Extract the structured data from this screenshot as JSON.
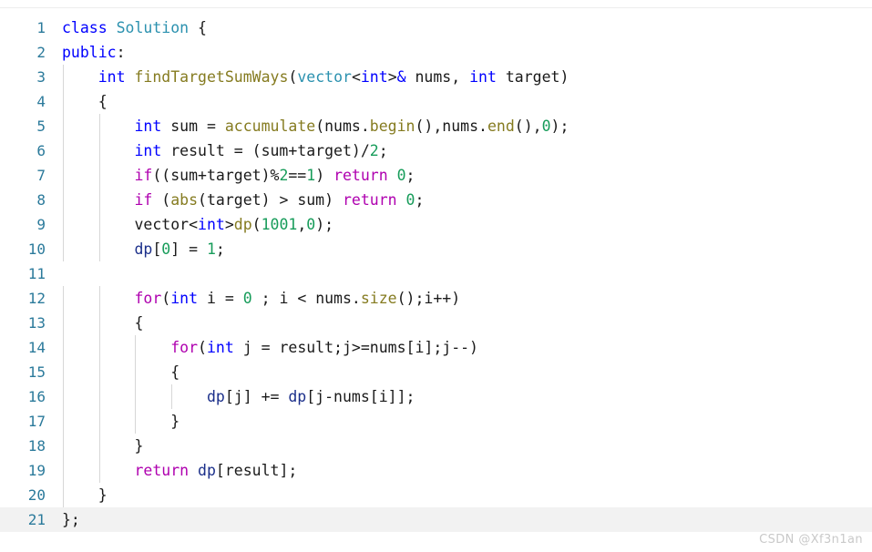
{
  "editor": {
    "language": "cpp",
    "total_lines": 21,
    "current_line": 21,
    "gutter_color": "#2b7a9b",
    "background": "#ffffff",
    "current_line_background": "#f2f2f2"
  },
  "palette": {
    "keyword": "#0000ff",
    "control": "#af00af",
    "type": "#2b91af",
    "function": "#857b20",
    "number": "#179c5a",
    "variable": "#1b2f8a",
    "plain": "#1a1a1a",
    "indent_guide": "#d7d7d7"
  },
  "watermark": {
    "text": "CSDN @Xf3n1an"
  },
  "code": {
    "plain_text": "class Solution {\npublic:\n    int findTargetSumWays(vector<int>& nums, int target)\n    {\n        int sum = accumulate(nums.begin(),nums.end(),0);\n        int result = (sum+target)/2;\n        if((sum+target)%2==1) return 0;\n        if (abs(target) > sum) return 0;\n        vector<int>dp(1001,0);\n        dp[0] = 1;\n\n        for(int i = 0 ; i < nums.size();i++)\n        {\n            for(int j = result;j>=nums[i];j--)\n            {\n                dp[j] += dp[j-nums[i]];\n            }\n        }\n        return dp[result];\n    }\n};",
    "lines": [
      {
        "number": "1",
        "guides": [],
        "tokens": [
          {
            "t": "class",
            "c": "t-kw"
          },
          {
            "t": " ",
            "c": "t-plain"
          },
          {
            "t": "Solution",
            "c": "t-type"
          },
          {
            "t": " {",
            "c": "t-plain"
          }
        ]
      },
      {
        "number": "2",
        "guides": [],
        "tokens": [
          {
            "t": "public",
            "c": "t-kw"
          },
          {
            "t": ":",
            "c": "t-plain"
          }
        ]
      },
      {
        "number": "3",
        "guides": [
          0
        ],
        "tokens": [
          {
            "t": "    ",
            "c": "t-plain"
          },
          {
            "t": "int",
            "c": "t-kw"
          },
          {
            "t": " ",
            "c": "t-plain"
          },
          {
            "t": "findTargetSumWays",
            "c": "t-fn"
          },
          {
            "t": "(",
            "c": "t-plain"
          },
          {
            "t": "vector",
            "c": "t-type"
          },
          {
            "t": "<",
            "c": "t-plain"
          },
          {
            "t": "int",
            "c": "t-kw"
          },
          {
            "t": ">",
            "c": "t-plain"
          },
          {
            "t": "&",
            "c": "t-kw"
          },
          {
            "t": " nums, ",
            "c": "t-plain"
          },
          {
            "t": "int",
            "c": "t-kw"
          },
          {
            "t": " target)",
            "c": "t-plain"
          }
        ]
      },
      {
        "number": "4",
        "guides": [
          0
        ],
        "tokens": [
          {
            "t": "    {",
            "c": "t-plain"
          }
        ]
      },
      {
        "number": "5",
        "guides": [
          0,
          1
        ],
        "tokens": [
          {
            "t": "        ",
            "c": "t-plain"
          },
          {
            "t": "int",
            "c": "t-kw"
          },
          {
            "t": " sum = ",
            "c": "t-plain"
          },
          {
            "t": "accumulate",
            "c": "t-fn"
          },
          {
            "t": "(nums.",
            "c": "t-plain"
          },
          {
            "t": "begin",
            "c": "t-fn"
          },
          {
            "t": "(),nums.",
            "c": "t-plain"
          },
          {
            "t": "end",
            "c": "t-fn"
          },
          {
            "t": "(),",
            "c": "t-plain"
          },
          {
            "t": "0",
            "c": "t-num"
          },
          {
            "t": ");",
            "c": "t-plain"
          }
        ]
      },
      {
        "number": "6",
        "guides": [
          0,
          1
        ],
        "tokens": [
          {
            "t": "        ",
            "c": "t-plain"
          },
          {
            "t": "int",
            "c": "t-kw"
          },
          {
            "t": " result = (sum+target)/",
            "c": "t-plain"
          },
          {
            "t": "2",
            "c": "t-num"
          },
          {
            "t": ";",
            "c": "t-plain"
          }
        ]
      },
      {
        "number": "7",
        "guides": [
          0,
          1
        ],
        "tokens": [
          {
            "t": "        ",
            "c": "t-plain"
          },
          {
            "t": "if",
            "c": "t-ctrl"
          },
          {
            "t": "((sum+target)%",
            "c": "t-plain"
          },
          {
            "t": "2",
            "c": "t-num"
          },
          {
            "t": "==",
            "c": "t-plain"
          },
          {
            "t": "1",
            "c": "t-num"
          },
          {
            "t": ") ",
            "c": "t-plain"
          },
          {
            "t": "return",
            "c": "t-ctrl"
          },
          {
            "t": " ",
            "c": "t-plain"
          },
          {
            "t": "0",
            "c": "t-num"
          },
          {
            "t": ";",
            "c": "t-plain"
          }
        ]
      },
      {
        "number": "8",
        "guides": [
          0,
          1
        ],
        "tokens": [
          {
            "t": "        ",
            "c": "t-plain"
          },
          {
            "t": "if",
            "c": "t-ctrl"
          },
          {
            "t": " (",
            "c": "t-plain"
          },
          {
            "t": "abs",
            "c": "t-fn"
          },
          {
            "t": "(target) > sum) ",
            "c": "t-plain"
          },
          {
            "t": "return",
            "c": "t-ctrl"
          },
          {
            "t": " ",
            "c": "t-plain"
          },
          {
            "t": "0",
            "c": "t-num"
          },
          {
            "t": ";",
            "c": "t-plain"
          }
        ]
      },
      {
        "number": "9",
        "guides": [
          0,
          1
        ],
        "tokens": [
          {
            "t": "        vector<",
            "c": "t-plain"
          },
          {
            "t": "int",
            "c": "t-kw"
          },
          {
            "t": ">",
            "c": "t-plain"
          },
          {
            "t": "dp",
            "c": "t-fn"
          },
          {
            "t": "(",
            "c": "t-plain"
          },
          {
            "t": "1001",
            "c": "t-num"
          },
          {
            "t": ",",
            "c": "t-plain"
          },
          {
            "t": "0",
            "c": "t-num"
          },
          {
            "t": ");",
            "c": "t-plain"
          }
        ]
      },
      {
        "number": "10",
        "guides": [
          0,
          1
        ],
        "tokens": [
          {
            "t": "        ",
            "c": "t-plain"
          },
          {
            "t": "dp",
            "c": "t-var"
          },
          {
            "t": "[",
            "c": "t-plain"
          },
          {
            "t": "0",
            "c": "t-num"
          },
          {
            "t": "] = ",
            "c": "t-plain"
          },
          {
            "t": "1",
            "c": "t-num"
          },
          {
            "t": ";",
            "c": "t-plain"
          }
        ]
      },
      {
        "number": "11",
        "guides": [
          0,
          1
        ],
        "tokens": [
          {
            "t": "",
            "c": "t-plain"
          }
        ]
      },
      {
        "number": "12",
        "guides": [
          0,
          1
        ],
        "tokens": [
          {
            "t": "        ",
            "c": "t-plain"
          },
          {
            "t": "for",
            "c": "t-ctrl"
          },
          {
            "t": "(",
            "c": "t-plain"
          },
          {
            "t": "int",
            "c": "t-kw"
          },
          {
            "t": " i = ",
            "c": "t-plain"
          },
          {
            "t": "0",
            "c": "t-num"
          },
          {
            "t": " ; i < nums.",
            "c": "t-plain"
          },
          {
            "t": "size",
            "c": "t-fn"
          },
          {
            "t": "();i++)",
            "c": "t-plain"
          }
        ]
      },
      {
        "number": "13",
        "guides": [
          0,
          1
        ],
        "tokens": [
          {
            "t": "        {",
            "c": "t-plain"
          }
        ]
      },
      {
        "number": "14",
        "guides": [
          0,
          1,
          2
        ],
        "tokens": [
          {
            "t": "            ",
            "c": "t-plain"
          },
          {
            "t": "for",
            "c": "t-ctrl"
          },
          {
            "t": "(",
            "c": "t-plain"
          },
          {
            "t": "int",
            "c": "t-kw"
          },
          {
            "t": " j = result;j>=nums[i];j--)",
            "c": "t-plain"
          }
        ]
      },
      {
        "number": "15",
        "guides": [
          0,
          1,
          2
        ],
        "tokens": [
          {
            "t": "            {",
            "c": "t-plain"
          }
        ]
      },
      {
        "number": "16",
        "guides": [
          0,
          1,
          2,
          3
        ],
        "tokens": [
          {
            "t": "                ",
            "c": "t-plain"
          },
          {
            "t": "dp",
            "c": "t-var"
          },
          {
            "t": "[j] += ",
            "c": "t-plain"
          },
          {
            "t": "dp",
            "c": "t-var"
          },
          {
            "t": "[j-nums[i]];",
            "c": "t-plain"
          }
        ]
      },
      {
        "number": "17",
        "guides": [
          0,
          1,
          2
        ],
        "tokens": [
          {
            "t": "            }",
            "c": "t-plain"
          }
        ]
      },
      {
        "number": "18",
        "guides": [
          0,
          1
        ],
        "tokens": [
          {
            "t": "        }",
            "c": "t-plain"
          }
        ]
      },
      {
        "number": "19",
        "guides": [
          0,
          1
        ],
        "tokens": [
          {
            "t": "        ",
            "c": "t-plain"
          },
          {
            "t": "return",
            "c": "t-ctrl"
          },
          {
            "t": " ",
            "c": "t-plain"
          },
          {
            "t": "dp",
            "c": "t-var"
          },
          {
            "t": "[result];",
            "c": "t-plain"
          }
        ]
      },
      {
        "number": "20",
        "guides": [
          0
        ],
        "tokens": [
          {
            "t": "    }",
            "c": "t-plain"
          }
        ]
      },
      {
        "number": "21",
        "guides": [],
        "current": true,
        "tokens": [
          {
            "t": "};",
            "c": "t-plain"
          }
        ]
      }
    ]
  }
}
